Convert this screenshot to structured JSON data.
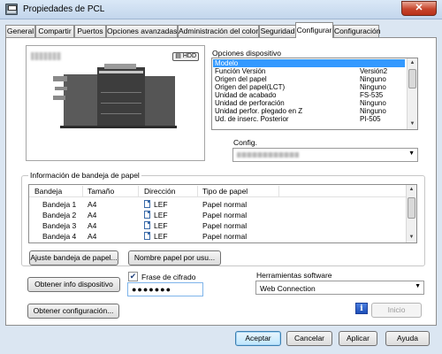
{
  "window": {
    "title": "Propiedades de PCL",
    "close_label": "✕"
  },
  "tabs": [
    {
      "label": "General"
    },
    {
      "label": "Compartir"
    },
    {
      "label": "Puertos"
    },
    {
      "label": "Opciones avanzadas"
    },
    {
      "label": "Administración del color"
    },
    {
      "label": "Seguridad"
    },
    {
      "label": "Configurar"
    },
    {
      "label": "Configuración"
    }
  ],
  "active_tab": "Configurar",
  "image": {
    "badge": "HDD"
  },
  "device_options": {
    "label": "Opciones dispositivo",
    "rows": [
      {
        "name": "Modelo",
        "value": "",
        "selected": true
      },
      {
        "name": "Función Versión",
        "value": "Versión2"
      },
      {
        "name": "Origen del papel",
        "value": "Ninguno"
      },
      {
        "name": "Origen del papel(LCT)",
        "value": "Ninguno"
      },
      {
        "name": "Unidad de acabado",
        "value": "FS-535"
      },
      {
        "name": "Unidad de perforación",
        "value": "Ninguno"
      },
      {
        "name": "Unidad perfor. plegado en Z",
        "value": "Ninguno"
      },
      {
        "name": "Ud. de inserc. Posterior",
        "value": "PI-505"
      }
    ],
    "config_label": "Config."
  },
  "tray_info": {
    "label": "Información de bandeja de papel",
    "columns": [
      "Bandeja",
      "Tamaño",
      "Dirección",
      "Tipo de papel"
    ],
    "rows": [
      {
        "tray": "Bandeja 1",
        "size": "A4",
        "direction": "LEF",
        "type": "Papel normal"
      },
      {
        "tray": "Bandeja 2",
        "size": "A4",
        "direction": "LEF",
        "type": "Papel normal"
      },
      {
        "tray": "Bandeja 3",
        "size": "A4",
        "direction": "LEF",
        "type": "Papel normal"
      },
      {
        "tray": "Bandeja 4",
        "size": "A4",
        "direction": "LEF",
        "type": "Papel normal"
      }
    ],
    "set_tray_button": "Ajuste bandeja de papel...",
    "paper_name_button": "Nombre papel por usu..."
  },
  "device_info": {
    "get_button": "Obtener info dispositivo",
    "passphrase_label": "Frase de cifrado",
    "passphrase_checked": true,
    "passphrase_value": "●●●●●●●"
  },
  "software_tools": {
    "label": "Herramientas software",
    "selected": "Web Connection",
    "start_button": "Inicio"
  },
  "get_config_button": "Obtener configuración...",
  "footer": {
    "ok": "Aceptar",
    "cancel": "Cancelar",
    "apply": "Aplicar",
    "help": "Ayuda"
  }
}
